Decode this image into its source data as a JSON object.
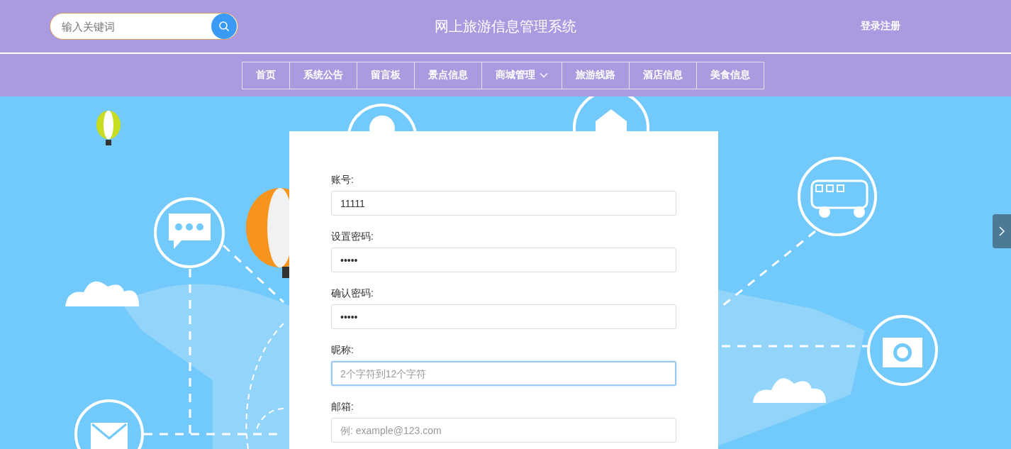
{
  "header": {
    "search": {
      "placeholder": "输入关键词"
    },
    "title": "网上旅游信息管理系统",
    "login_link": "登录注册"
  },
  "nav": [
    {
      "label": "首页",
      "has_menu": false
    },
    {
      "label": "系统公告",
      "has_menu": false
    },
    {
      "label": "留言板",
      "has_menu": false
    },
    {
      "label": "景点信息",
      "has_menu": false
    },
    {
      "label": "商城管理",
      "has_menu": true
    },
    {
      "label": "旅游线路",
      "has_menu": false
    },
    {
      "label": "酒店信息",
      "has_menu": false
    },
    {
      "label": "美食信息",
      "has_menu": false
    }
  ],
  "form": {
    "fields": [
      {
        "label": "账号:",
        "value": "11111",
        "focused": false
      },
      {
        "label": "设置密码:",
        "value": "•••••",
        "focused": false
      },
      {
        "label": "确认密码:",
        "value": "•••••",
        "focused": false
      },
      {
        "label": "昵称:",
        "placeholder": "2个字符到12个字符",
        "focused": true
      },
      {
        "label": "邮箱:",
        "placeholder": "例: example@123.com",
        "focused": false
      }
    ]
  }
}
